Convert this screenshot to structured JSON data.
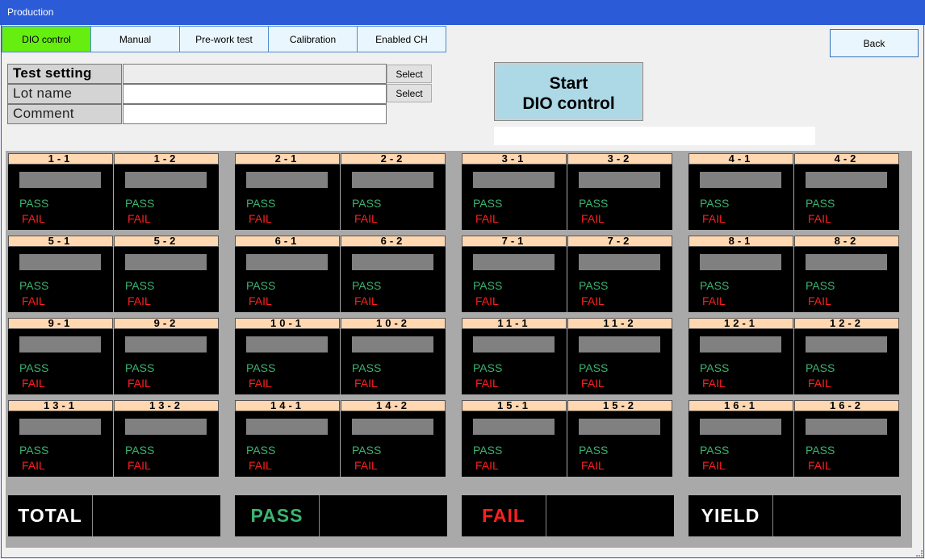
{
  "window": {
    "title": "Production"
  },
  "tabs": [
    {
      "label": "DIO control",
      "active": true
    },
    {
      "label": "Manual",
      "active": false
    },
    {
      "label": "Pre-work test",
      "active": false
    },
    {
      "label": "Calibration",
      "active": false
    },
    {
      "label": "Enabled CH",
      "active": false
    }
  ],
  "back_label": "Back",
  "form": {
    "test_setting": {
      "label": "Test setting",
      "value": "",
      "select_label": "Select"
    },
    "lot_name": {
      "label": "Lot name",
      "value": "",
      "select_label": "Select"
    },
    "comment": {
      "label": "Comment",
      "value": ""
    }
  },
  "start_button": {
    "label": "Start\nDIO control"
  },
  "status_text": "",
  "channels": {
    "pass_label": "PASS",
    "fail_label": "FAIL",
    "items": [
      "1-1",
      "1-2",
      "2-1",
      "2-2",
      "3-1",
      "3-2",
      "4-1",
      "4-2",
      "5-1",
      "5-2",
      "6-1",
      "6-2",
      "7-1",
      "7-2",
      "8-1",
      "8-2",
      "9-1",
      "9-2",
      "10-1",
      "10-2",
      "11-1",
      "11-2",
      "12-1",
      "12-2",
      "13-1",
      "13-2",
      "14-1",
      "14-2",
      "15-1",
      "15-2",
      "16-1",
      "16-2"
    ]
  },
  "summary": [
    {
      "label": "TOTAL",
      "value": "",
      "color": "#ffffff"
    },
    {
      "label": "PASS",
      "value": "",
      "color": "#3cb371"
    },
    {
      "label": "FAIL",
      "value": "",
      "color": "#ff1f1f"
    },
    {
      "label": "YIELD",
      "value": "",
      "color": "#ffffff"
    }
  ],
  "colors": {
    "titlebar": "#2b5bd7",
    "active_tab": "#66ee11",
    "start_button": "#add8e6",
    "cell_header": "#ffd8b1",
    "pass": "#3cb371",
    "fail": "#ff1f1f"
  }
}
